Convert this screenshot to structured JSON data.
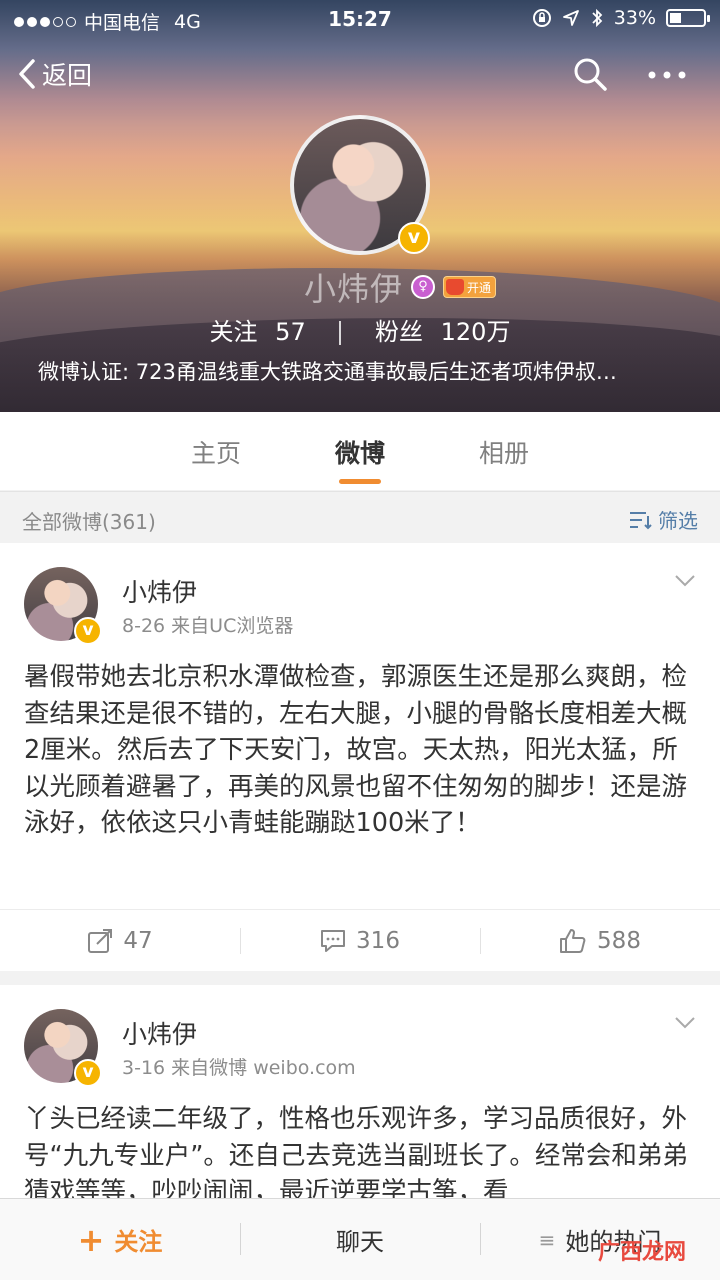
{
  "status_bar": {
    "carrier": "中国电信",
    "network": "4G",
    "time": "15:27",
    "battery": "33%",
    "battery_level": 0.33
  },
  "nav": {
    "back_label": "返回"
  },
  "profile": {
    "name": "小炜伊",
    "member_badge": "开通",
    "following_label": "关注",
    "following_count": "57",
    "followers_label": "粉丝",
    "followers_count": "120万",
    "verification": "微博认证: 723甬温线重大铁路交通事故最后生还者项炜伊叔…"
  },
  "tabs": [
    {
      "label": "主页"
    },
    {
      "label": "微博"
    },
    {
      "label": "相册"
    }
  ],
  "active_tab_index": 1,
  "filter_bar": {
    "count_label": "全部微博(361)",
    "filter_label": "筛选"
  },
  "posts": [
    {
      "author": "小炜伊",
      "meta": "8-26  来自UC浏览器",
      "content": "暑假带她去北京积水潭做检查，郭源医生还是那么爽朗，检查结果还是很不错的，左右大腿，小腿的骨骼长度相差大概2厘米。然后去了下天安门，故宫。天太热，阳光太猛，所以光顾着避暑了，再美的风景也留不住匆匆的脚步！还是游泳好，依依这只小青蛙能蹦跶100米了！",
      "reposts": "47",
      "comments": "316",
      "likes": "588"
    },
    {
      "author": "小炜伊",
      "meta": "3-16  来自微博 weibo.com",
      "content": "丫头已经读二年级了，性格也乐观许多，学习品质很好，外号“九九专业户”。还自己去竞选当副班长了。经常会和弟弟猜戏等等，吵吵闹闹，最近逆要学古筝，看"
    }
  ],
  "bottom_bar": {
    "follow_label": "关注",
    "chat_label": "聊天",
    "hot_label": "她的热门"
  },
  "watermark": "广西龙网",
  "colors": {
    "accent": "#f08c31",
    "link": "#557ea8",
    "verified": "#f6b400"
  }
}
